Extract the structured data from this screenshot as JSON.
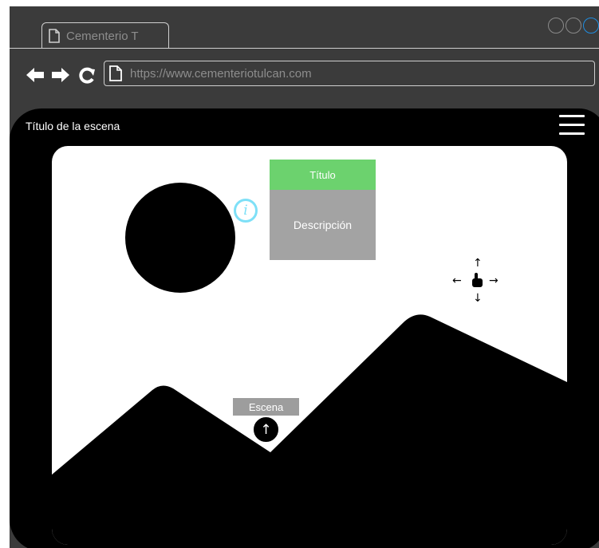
{
  "browser": {
    "tab_title": "Cementerio T",
    "url": "https://www.cementeriotulcan.com",
    "icons": [
      "page-icon",
      "back-arrow-icon",
      "forward-arrow-icon",
      "reload-icon"
    ]
  },
  "header": {
    "title": "Título de la escena",
    "menu_icon": "hamburger-menu-icon"
  },
  "hotspot": {
    "title": "Título",
    "description": "Descripción",
    "info_icon": "info-icon",
    "title_color": "#6cd26e",
    "description_color": "#a3a3a3",
    "info_color": "#7ee0f7"
  },
  "scene_link": {
    "label": "Escena",
    "icon": "arrow-up-icon"
  },
  "navigation_hint": {
    "icon": "drag-hand-icon"
  }
}
